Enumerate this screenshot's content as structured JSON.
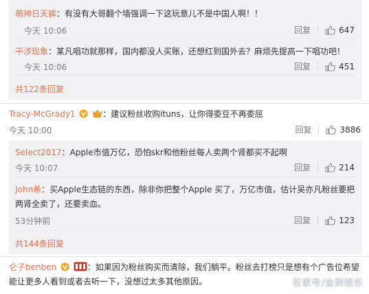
{
  "thread1": {
    "replies": [
      {
        "user": "萌神日天裤",
        "text": "：有没有大哥翻个墙强调一下这玩意儿不是中国人啊！！",
        "time": "今天 10:06",
        "reply_label": "回复",
        "likes": "647"
      },
      {
        "user": "干涉现象",
        "text": "：某凡唱功就那样，国内都没人买账，还想红到国外去？麻烦先提高一下唱功吧！",
        "time": "今天 10:06",
        "reply_label": "回复",
        "likes": "451"
      }
    ],
    "more": "共122条回复"
  },
  "comment2": {
    "user": "Tracy-McGrady1",
    "text": "：建议粉丝收购ituns，让你得委豆不再委屈",
    "time": "今天 10:00",
    "reply_label": "回复",
    "likes": "3886",
    "replies": [
      {
        "user": "Select2017",
        "text": "：Apple市值万亿，恐怕skr和他粉丝每人卖两个肾都买不起啊",
        "time": "今天 10:07",
        "reply_label": "回复",
        "likes": "214"
      },
      {
        "user": "John希",
        "text": "：买Apple生态链的东西，除非你把整个Apple 买了，万亿市值，估计吴亦凡粉丝要把",
        "text2": "两肾全卖了，还要卖血。",
        "time": "53分钟前",
        "reply_label": "回复",
        "likes": "123"
      }
    ],
    "more": "共144条回复"
  },
  "comment3": {
    "user": "仑子benben",
    "text": "：如果因为粉丝购买而清除，我们躺平。粉丝去打榜只是想有个广告位希望",
    "text2": "能让更多人看到或者去听一下，没想过太多其他原因。"
  },
  "watermark": "百家号/金牌娱乐",
  "colors": {
    "username": "#eb7350",
    "reply_bg": "#f2f2f5",
    "meta": "#808080"
  },
  "icons": [
    "thumb-up-icon",
    "vip-v-icon",
    "crown-icon",
    "member-badge-icon"
  ]
}
